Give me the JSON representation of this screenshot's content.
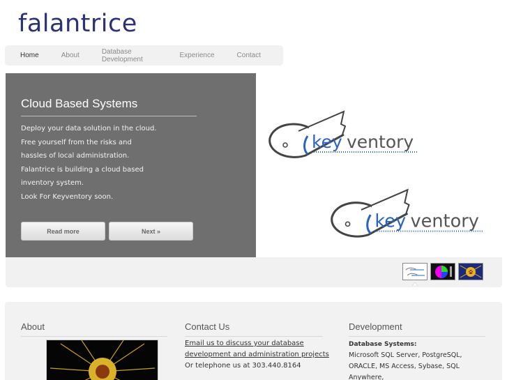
{
  "site": {
    "logo_text": "falantrice"
  },
  "nav": {
    "items": [
      {
        "label": "Home",
        "active": true
      },
      {
        "label": "About",
        "active": false
      },
      {
        "label": "Database Development",
        "active": false
      },
      {
        "label": "Experience",
        "active": false
      },
      {
        "label": "Contact",
        "active": false
      }
    ]
  },
  "slide": {
    "title": "Cloud Based Systems",
    "lines": [
      "Deploy your data solution in the cloud.",
      "Free yourself from the risks and",
      "hassles of local administration.",
      "Falantrice is building a cloud based",
      "inventory system.",
      "Look For Keyventory soon."
    ],
    "read_more_label": "Read more",
    "next_label": "Next »",
    "logo_word_1": "key",
    "logo_word_2": "ventory"
  },
  "footer": {
    "about_heading": "About",
    "contact_heading": "Contact Us",
    "contact_link": "Email us to discuss your database development and administration projects",
    "contact_phone": "Or telephone us at 303.440.8164",
    "development_heading": "Development",
    "dev_label": "Database Systems:",
    "dev_text": "Microsoft SQL Server, PostgreSQL, ORACLE, MS Access, Sybase, SQL Anywhere,"
  },
  "colors": {
    "logo": "#2b3275",
    "slide_bg": "#6f6f6f",
    "keyventory_blue": "#2a63c7",
    "keyventory_gray": "#555555"
  }
}
